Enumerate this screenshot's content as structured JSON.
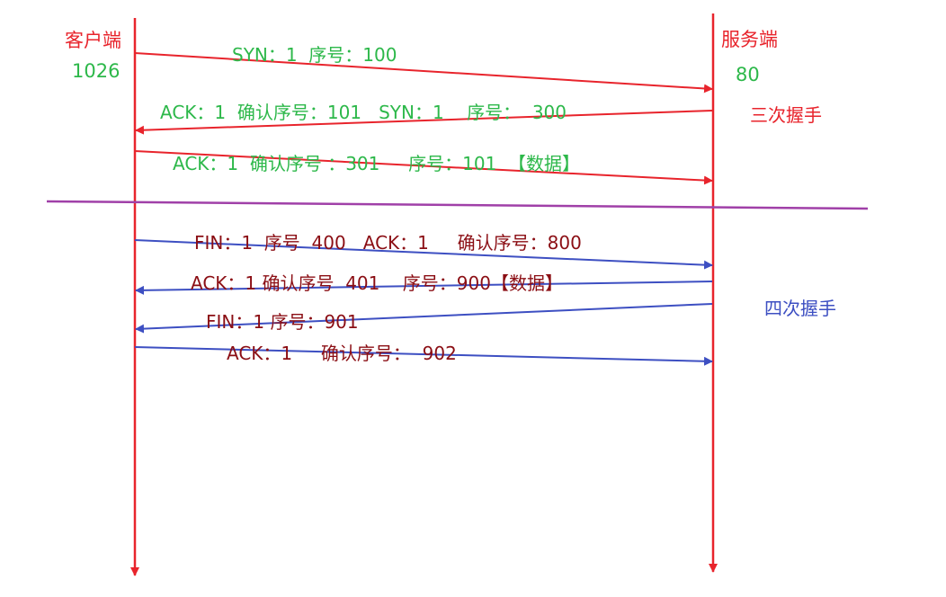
{
  "colors": {
    "lifeline": "#e8242c",
    "handshake_arrow": "#e8242c",
    "handshake_text": "#2db84a",
    "wave_arrow": "#3d4fc2",
    "wave_text": "#8b0e14",
    "wave_title": "#3d4fc2",
    "divider": "#a040a8"
  },
  "client": {
    "label": "客户端",
    "port": "1026"
  },
  "server": {
    "label": "服务端",
    "port": "80"
  },
  "handshake": {
    "title": "三次握手",
    "messages": [
      {
        "text": "SYN：1  序号：100",
        "direction": "client-to-server"
      },
      {
        "text": "ACK：1  确认序号：101   SYN：1    序号：  300",
        "direction": "server-to-client"
      },
      {
        "text": "ACK：1  确认序号 ：301     序号：101  【数据】",
        "direction": "client-to-server"
      }
    ]
  },
  "wave": {
    "title": "四次握手",
    "messages": [
      {
        "text": "FIN：1  序号  400   ACK：1     确认序号：800",
        "direction": "client-to-server"
      },
      {
        "text": "ACK：1 确认序号  401    序号：900【数据】",
        "direction": "server-to-client"
      },
      {
        "text": "FIN：1 序号：901",
        "direction": "server-to-client"
      },
      {
        "text": "ACK：1     确认序号：  902",
        "direction": "client-to-server"
      }
    ]
  }
}
